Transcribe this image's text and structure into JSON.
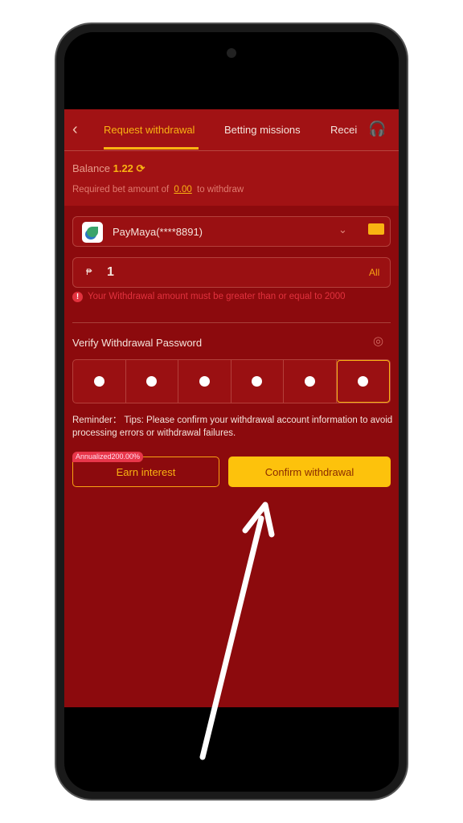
{
  "header": {
    "back_icon": "chevron-left-icon",
    "tabs": [
      {
        "label": "Request withdrawal",
        "active": true
      },
      {
        "label": "Betting missions"
      },
      {
        "label": "Recei"
      }
    ],
    "support_icon": "headset-icon"
  },
  "balance": {
    "label": "Balance",
    "value": "1.22",
    "refresh_icon": "refresh-icon"
  },
  "requirement": {
    "prefix": "Required bet amount of",
    "amount": "0.00",
    "suffix": "to withdraw"
  },
  "account": {
    "name": "PayMaya(****8891)",
    "manage_icon": "card-settings-icon"
  },
  "amount": {
    "currency": "₱",
    "value": "1",
    "all_label": "All"
  },
  "error": "Your Withdrawal amount must be greater than or equal to 2000",
  "password": {
    "label": "Verify Withdrawal Password",
    "digits": 6
  },
  "reminder": "Reminder： Tips: Please confirm your withdrawal account information to avoid processing errors or withdrawal failures.",
  "buttons": {
    "earn": "Earn interest",
    "earn_badge": "Annualized200.00%",
    "confirm": "Confirm withdrawal"
  },
  "colors": {
    "accent": "#f9b312",
    "background": "#8c0a0d",
    "error": "#e2323e"
  }
}
